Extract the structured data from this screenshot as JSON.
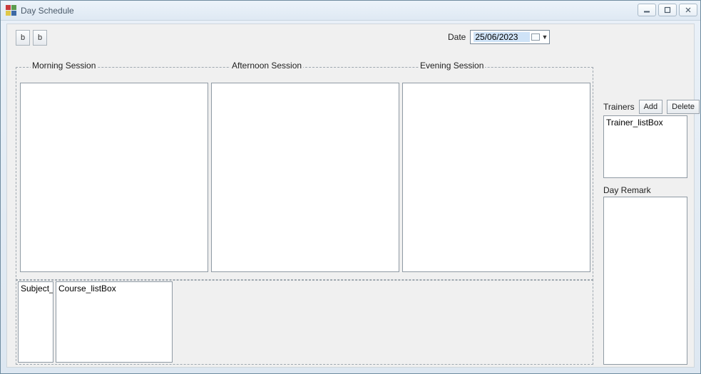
{
  "window": {
    "title": "Day Schedule"
  },
  "toolbar": {
    "btn1": "b",
    "btn2": "b"
  },
  "date": {
    "label": "Date",
    "value": "25/06/2023"
  },
  "sessions": {
    "morning_label": "Morning Session",
    "afternoon_label": "Afternoon Session",
    "evening_label": "Evening Session"
  },
  "bottom": {
    "subject_text": "Subject_li",
    "course_text": "Course_listBox"
  },
  "trainers": {
    "label": "Trainers",
    "add_label": "Add",
    "delete_label": "Delete",
    "list_text": "Trainer_listBox"
  },
  "remark": {
    "label": "Day Remark",
    "value": ""
  }
}
